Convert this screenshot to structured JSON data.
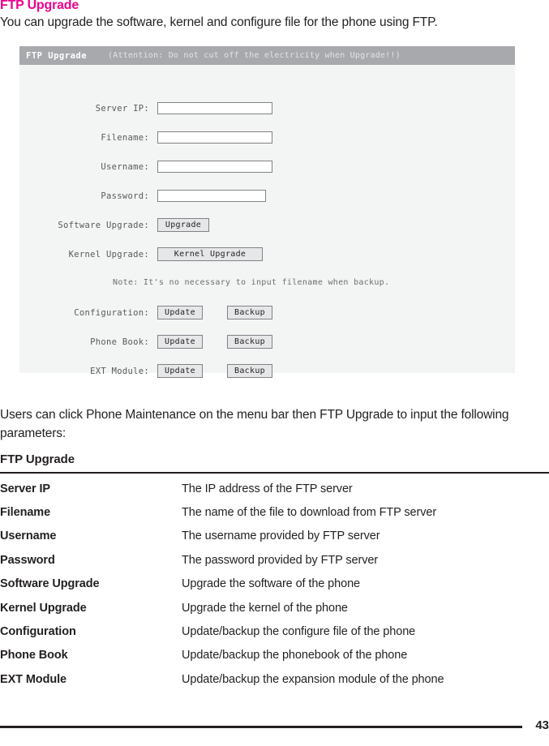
{
  "document": {
    "title": "FTP Upgrade",
    "title_color": "#ec008c",
    "intro": "You can upgrade the software, kernel and configure file for the phone using FTP.",
    "paragraph": "Users can click Phone Maintenance on the menu bar then FTP Upgrade to input the following parameters:",
    "subtitle": "FTP Upgrade",
    "page_number": "43"
  },
  "screenshot": {
    "header": {
      "title": "FTP Upgrade",
      "attention": "(Attention: Do not cut off the electricity when Upgrade!!)",
      "bg_color": "#a7a9ac",
      "text_color": "#ffffff"
    },
    "panel_bg_color": "#f3f4f4",
    "fields": [
      {
        "label": "Server IP:",
        "value": "",
        "placeholder": ""
      },
      {
        "label": "Filename:",
        "value": "",
        "placeholder": ""
      },
      {
        "label": "Username:",
        "value": "",
        "placeholder": ""
      },
      {
        "label": "Password:",
        "value": "",
        "placeholder": ""
      }
    ],
    "software_upgrade": {
      "label": "Software Upgrade:",
      "button": "Upgrade"
    },
    "kernel_upgrade": {
      "label": "Kernel Upgrade:",
      "button": "Kernel Upgrade"
    },
    "note": "Note: It's no necessary to input filename when backup.",
    "action_rows": [
      {
        "label": "Configuration:",
        "update": "Update",
        "backup": "Backup"
      },
      {
        "label": "Phone Book:",
        "update": "Update",
        "backup": "Backup"
      },
      {
        "label": "EXT Module:",
        "update": "Update",
        "backup": "Backup"
      }
    ]
  },
  "definitions": [
    {
      "term": "Server IP",
      "desc": "The IP address of the FTP server"
    },
    {
      "term": "Filename",
      "desc": "The name of the file to download from FTP server"
    },
    {
      "term": "Username",
      "desc": "The username provided by FTP server"
    },
    {
      "term": "Password",
      "desc": "The password provided by FTP server"
    },
    {
      "term": "Software Upgrade",
      "desc": "Upgrade the software of the phone"
    },
    {
      "term": "Kernel Upgrade",
      "desc": "Upgrade the kernel of the phone"
    },
    {
      "term": "Configuration",
      "desc": "Update/backup the configure file of the phone"
    },
    {
      "term": "Phone Book",
      "desc": "Update/backup the phonebook of the phone"
    },
    {
      "term": "EXT Module",
      "desc": "Update/backup the expansion module of the phone"
    }
  ]
}
